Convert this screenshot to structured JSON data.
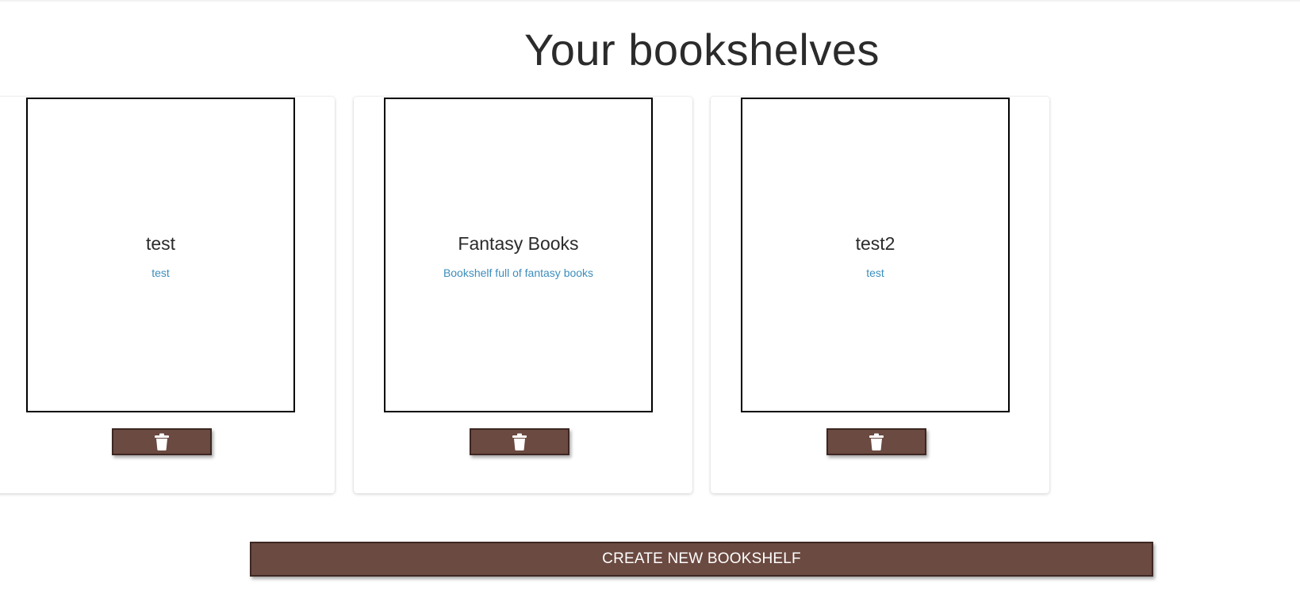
{
  "page_title": "Your bookshelves",
  "bookshelves": [
    {
      "name": "test",
      "description": "test",
      "delete_icon": "trash-icon"
    },
    {
      "name": "Fantasy Books",
      "description": "Bookshelf full of fantasy books",
      "delete_icon": "trash-icon"
    },
    {
      "name": "test2",
      "description": "test",
      "delete_icon": "trash-icon"
    }
  ],
  "create_button_label": "CREATE NEW BOOKSHELF",
  "colors": {
    "button_bg": "#6b4a41",
    "button_border": "#3d2722",
    "description_link": "#3c8dbc",
    "title_text": "#2b2b2b"
  }
}
